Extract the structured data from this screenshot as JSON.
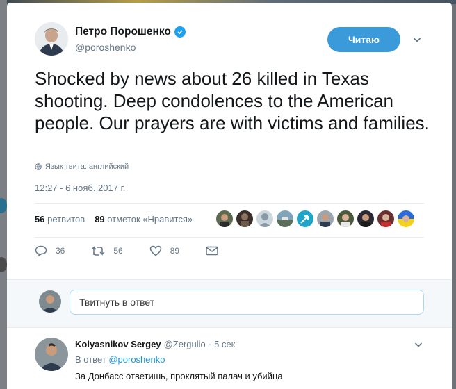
{
  "tweet": {
    "author": {
      "display_name": "Петро Порошенко",
      "handle": "@poroshenko",
      "verified": true
    },
    "follow_button_label": "Читаю",
    "text": "Shocked by news about 26 killed in Texas shooting. Deep condolences to the American people. Our prayers are with victims and families.",
    "language_note": "Язык твита: английский",
    "timestamp": "12:27 - 6 нояб. 2017 г.",
    "stats": {
      "retweets_count": "56",
      "retweets_label": "ретвитов",
      "likes_count": "89",
      "likes_label": "отметок «Нравится»"
    },
    "liker_avatars": [
      "avatar",
      "avatar",
      "default-avatar",
      "avatar",
      "avatar",
      "avatar",
      "avatar",
      "avatar",
      "avatar",
      "avatar"
    ],
    "actions": {
      "reply_count": "36",
      "retweet_count": "56",
      "like_count": "89"
    }
  },
  "reply_box": {
    "placeholder": "Твитнуть в ответ"
  },
  "reply": {
    "display_name": "Kolyasnikov Sergey",
    "handle": "@Zergulio",
    "separator": "·",
    "time": "5 сек",
    "in_reply_prefix": "В ответ",
    "in_reply_to": "@poroshenko",
    "text": "За Донбасс ответишь, проклятый палач и убийца"
  },
  "colors": {
    "accent": "#1da1f2",
    "follow_button": "#3b9ad9",
    "secondary_text": "#657786"
  }
}
